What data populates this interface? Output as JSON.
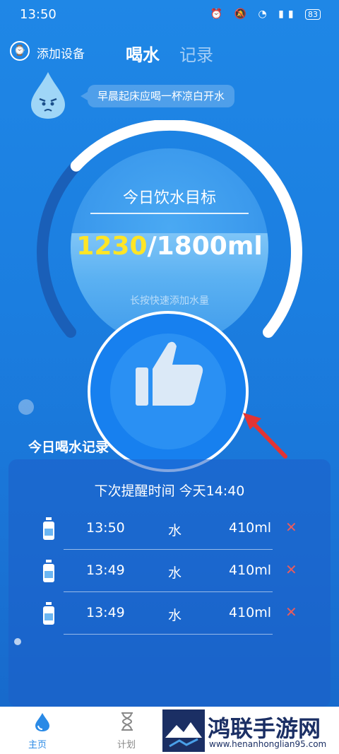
{
  "status": {
    "time": "13:50",
    "battery": "83"
  },
  "header": {
    "device_label": "添加设备",
    "tab_drink": "喝水",
    "tab_record": "记录"
  },
  "mascot": {
    "bubble_text": "早晨起床应喝一杯凉白开水"
  },
  "goal": {
    "label": "今日饮水目标",
    "current": "1230",
    "target": "/1800ml",
    "hint": "长按快速添加水量",
    "progress": 0.683
  },
  "today": {
    "title": "今日喝水记录",
    "next_reminder": "下次提醒时间 今天14:40"
  },
  "records": [
    {
      "time": "13:50",
      "kind": "水",
      "amount": "410ml",
      "delete": "✕"
    },
    {
      "time": "13:49",
      "kind": "水",
      "amount": "410ml",
      "delete": "✕"
    },
    {
      "time": "13:49",
      "kind": "水",
      "amount": "410ml",
      "delete": "✕"
    }
  ],
  "nav": {
    "home": "主页",
    "plan": "计划"
  },
  "watermark": {
    "title": "鸿联手游网",
    "url": "www.henanhonglian95.com"
  },
  "colors": {
    "accent": "#1780ef",
    "highlight": "#ffe526",
    "delete": "#e95c5c"
  }
}
